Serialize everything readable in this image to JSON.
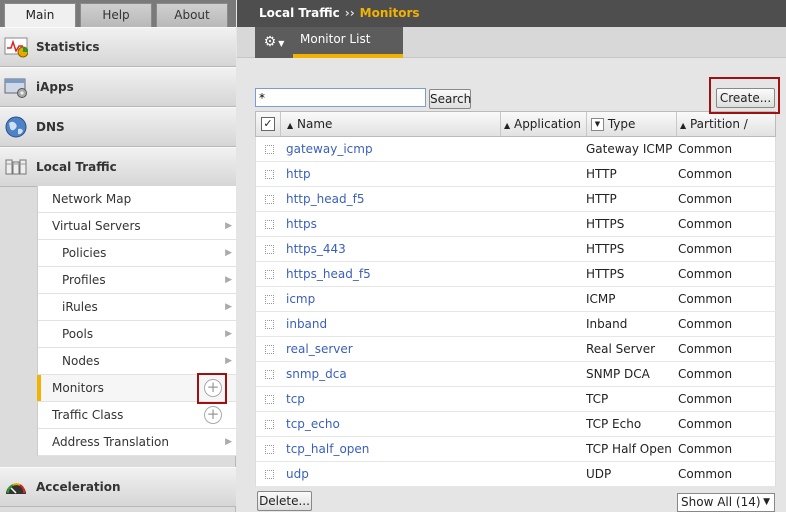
{
  "tabs": [
    "Main",
    "Help",
    "About"
  ],
  "nav_sections": {
    "statistics": "Statistics",
    "iapps": "iApps",
    "dns": "DNS",
    "local_traffic": "Local Traffic",
    "acceleration": "Acceleration"
  },
  "subnav": [
    {
      "label": "Network Map"
    },
    {
      "label": "Virtual Servers"
    },
    {
      "label": "Policies"
    },
    {
      "label": "Profiles"
    },
    {
      "label": "iRules"
    },
    {
      "label": "Pools"
    },
    {
      "label": "Nodes"
    },
    {
      "label": "Monitors"
    },
    {
      "label": "Traffic Class"
    },
    {
      "label": "Address Translation"
    }
  ],
  "breadcrumb": {
    "section": "Local Traffic",
    "separator": "››",
    "current": "Monitors"
  },
  "subtab": "Monitor List",
  "search": {
    "value": "*",
    "button": "Search"
  },
  "create_button": "Create...",
  "table": {
    "headers": {
      "name": "Name",
      "application": "Application",
      "type": "Type",
      "partition": "Partition / Path"
    },
    "rows": [
      {
        "name": "gateway_icmp",
        "type": "Gateway ICMP",
        "partition": "Common"
      },
      {
        "name": "http",
        "type": "HTTP",
        "partition": "Common"
      },
      {
        "name": "http_head_f5",
        "type": "HTTP",
        "partition": "Common"
      },
      {
        "name": "https",
        "type": "HTTPS",
        "partition": "Common"
      },
      {
        "name": "https_443",
        "type": "HTTPS",
        "partition": "Common"
      },
      {
        "name": "https_head_f5",
        "type": "HTTPS",
        "partition": "Common"
      },
      {
        "name": "icmp",
        "type": "ICMP",
        "partition": "Common"
      },
      {
        "name": "inband",
        "type": "Inband",
        "partition": "Common"
      },
      {
        "name": "real_server",
        "type": "Real Server",
        "partition": "Common"
      },
      {
        "name": "snmp_dca",
        "type": "SNMP DCA",
        "partition": "Common"
      },
      {
        "name": "tcp",
        "type": "TCP",
        "partition": "Common"
      },
      {
        "name": "tcp_echo",
        "type": "TCP Echo",
        "partition": "Common"
      },
      {
        "name": "tcp_half_open",
        "type": "TCP Half Open",
        "partition": "Common"
      },
      {
        "name": "udp",
        "type": "UDP",
        "partition": "Common"
      }
    ]
  },
  "delete_button": "Delete...",
  "show_all": "Show All (14)",
  "colors": {
    "accent": "#f2b300",
    "highlight_box": "#a01010",
    "link": "#3a5fbd"
  }
}
